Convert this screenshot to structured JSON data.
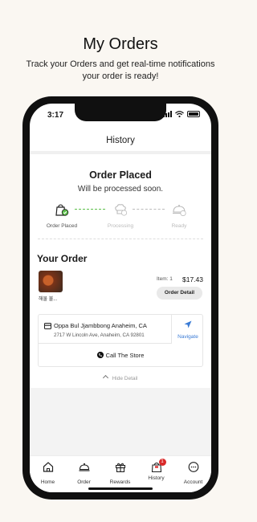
{
  "promo": {
    "title": "My Orders",
    "subtitle_line1": "Track your Orders and get real-time notifications",
    "subtitle_line2": "your order is ready!"
  },
  "status_bar": {
    "time": "3:17"
  },
  "header": {
    "title": "History"
  },
  "order": {
    "status_title": "Order Placed",
    "status_subtitle": "Will be processed soon.",
    "steps": [
      {
        "label": "Order Placed",
        "state": "done",
        "icon": "bag-check-icon"
      },
      {
        "label": "Processing",
        "state": "pending",
        "icon": "chef-hat-icon"
      },
      {
        "label": "Ready",
        "state": "pending",
        "icon": "cloche-icon"
      }
    ],
    "accent_color": "#5cc04a"
  },
  "your_order": {
    "title": "Your Order",
    "item": {
      "name": "해물 불...",
      "quantity": "Item: 1",
      "price": "$17.43",
      "detail_button": "Order Detail"
    }
  },
  "store": {
    "name": "Oppa Bul Jjambbong Anaheim, CA",
    "address": "2717 W Lincoln Ave, Anaheim, CA 92801",
    "navigate_label": "Navigate",
    "call_label": "Call The Store",
    "navigate_color": "#3a7bd5"
  },
  "hide_detail": "Hide Detail",
  "tabs": [
    {
      "label": "Home",
      "icon": "home-icon"
    },
    {
      "label": "Order",
      "icon": "cloche-icon"
    },
    {
      "label": "Rewards",
      "icon": "gift-icon"
    },
    {
      "label": "History",
      "icon": "history-bag-icon",
      "badge": "1"
    },
    {
      "label": "Account",
      "icon": "account-icon"
    }
  ]
}
